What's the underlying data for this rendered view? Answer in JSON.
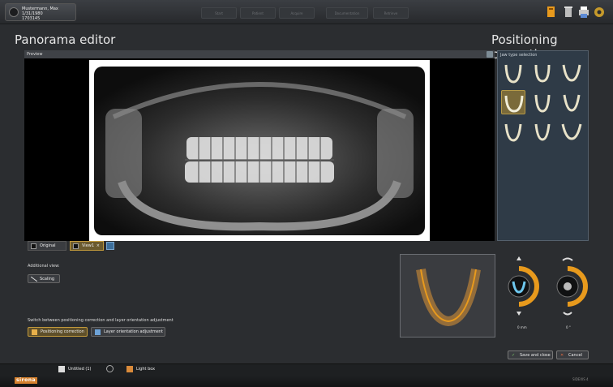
{
  "patient": {
    "name": "Mustermann, Max",
    "dob": "1/31/1980",
    "id": "1703145"
  },
  "workflow": [
    "Start",
    "Patient",
    "Acquire",
    "Documentation",
    "Retrieve"
  ],
  "title_left": "Panorama editor",
  "title_right": "Positioning correction",
  "preview_label": "Preview",
  "jaw_selection_label": "Jaw type selection",
  "view_tabs": {
    "original": "Original",
    "view1": "View1"
  },
  "additional_view_label": "Additional view:",
  "scaling_label": "Scaling",
  "switch_label": "Switch between positioning correction and layer orientation adjustment",
  "positioning_correction_btn": "Positioning correction",
  "layer_orientation_btn": "Layer orientation adjustment",
  "dial_left_value": "0 mm",
  "dial_right_value": "0 °",
  "save_close": "Save and close",
  "cancel": "Cancel",
  "bottom_tabs": {
    "untitled": "Untitled (1)",
    "lightbox": "Light box"
  },
  "brand": "sirona",
  "status_right": "SIDEXIS 4",
  "colors": {
    "accent": "#e89a1d",
    "bg": "#2b2d30",
    "panel_blue": "#2f3b47"
  }
}
